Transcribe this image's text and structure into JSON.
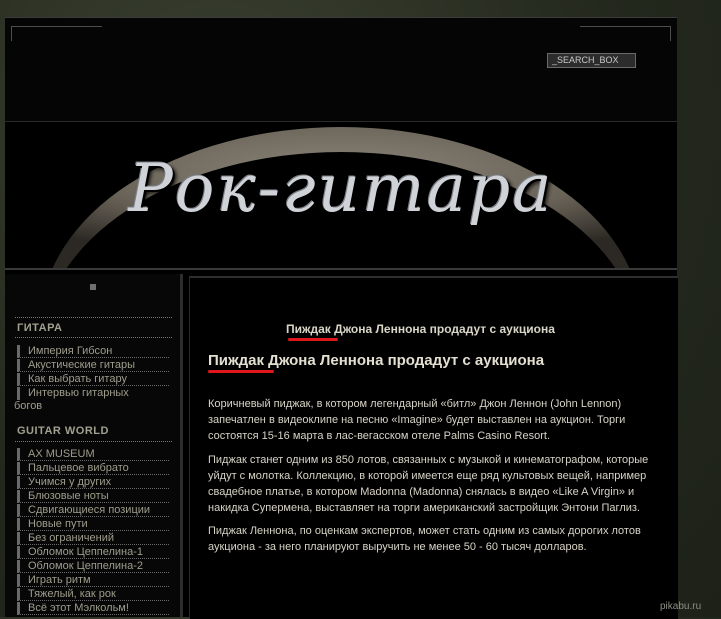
{
  "header": {
    "search_placeholder": "_SEARCH_BOX"
  },
  "banner": {
    "logo_text": "Рок-гитара"
  },
  "sidebar": {
    "section1": {
      "title": "ГИТАРА",
      "items": [
        "Империя Гибсон",
        "Акустические гитары",
        "Как выбрать гитару",
        "Интервью гитарных"
      ],
      "wrap_tail": "богов"
    },
    "section2": {
      "title": "GUITAR WORLD",
      "items": [
        "AX MUSEUM",
        "Пальцевое вибрато",
        "Учимся у других",
        "Блюзовые ноты",
        "Сдвигающиеся позиции",
        "Новые пути",
        "Без ограничений",
        "Обломок Цеппелина-1",
        "Обломок Цеппелина-2",
        "Играть ритм",
        "Тяжелый, как рок",
        "Всё этот Мэлкольм!"
      ]
    }
  },
  "content": {
    "breadcrumb": {
      "first_word": "Пиждак",
      "rest": " Джона Леннона продадут с аукциона"
    },
    "title": {
      "first_word": "Пиждак",
      "rest": " Джона Леннона продадут с аукциона"
    },
    "paragraphs": [
      "Коричневый пиджак, в котором легендарный «битл» Джон Леннон (John Lennon) запечатлен в видеоклипе на песню «Imagine» будет выставлен на аукцион. Торги состоятся 15-16 марта в лас-вегасском отеле Palms Casino Resort.",
      "Пиджак станет одним из 850 лотов, связанных с музыкой и кинематографом, которые уйдут с молотка. Коллекцию, в которой имеется еще ряд культовых вещей, например свадебное платье, в котором Madonna (Madonna) снялась в видео «Like A Virgin» и накидка Супермена, выставляет на торги американский застройщик Энтони Паглиз.",
      "Пиджак Леннона, по оценкам экспертов, может стать одним из самых дорогих лотов аукциона - за него планируют выручить не менее 50 - 60 тысяч долларов."
    ]
  },
  "watermark": "pikabu.ru",
  "colors": {
    "annotation_red": "#e0161d",
    "page_background": "#000000",
    "outer_background": "#2b3024",
    "sidebar_text": "#9f9d8c",
    "content_text": "#d7d4c6"
  }
}
